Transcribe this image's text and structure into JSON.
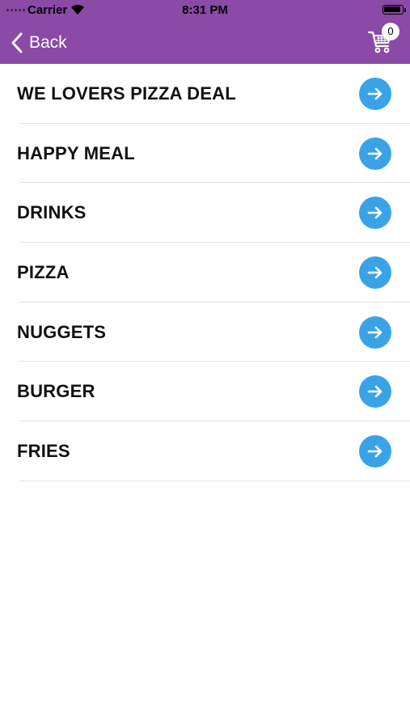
{
  "status_bar": {
    "carrier": "Carrier",
    "time": "8:31 PM"
  },
  "nav": {
    "back_label": "Back",
    "cart_count": "0"
  },
  "colors": {
    "header": "#8a4aa5",
    "arrow": "#3aa3e8"
  },
  "menu": {
    "items": [
      {
        "label": "WE LOVERS PIZZA DEAL"
      },
      {
        "label": "HAPPY MEAL"
      },
      {
        "label": "DRINKS"
      },
      {
        "label": "PIZZA"
      },
      {
        "label": "NUGGETS"
      },
      {
        "label": "BURGER"
      },
      {
        "label": "FRIES"
      }
    ]
  }
}
